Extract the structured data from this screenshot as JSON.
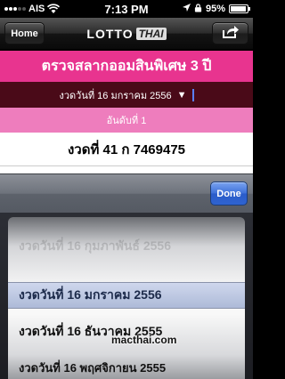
{
  "status_bar": {
    "carrier": "AIS",
    "time": "7:13 PM",
    "battery": "95%",
    "battery_level": 0.95,
    "signal_icon": "signal-dots-icon",
    "wifi_icon": "wifi-icon",
    "location_icon": "location-arrow-icon"
  },
  "navbar": {
    "home_label": "Home",
    "title_main": "LOTTO",
    "title_sub": "THAI",
    "share_icon": "share-icon"
  },
  "header": {
    "title": "ตรวจสลากออมสินพิเศษ 3 ปี"
  },
  "date_selector": {
    "value": "งวดวันที่ 16 มกราคม 2556",
    "arrow": "▼"
  },
  "rank": {
    "label": "อันดับที่ 1"
  },
  "result": {
    "text": "งวดที่ 41 ก 7469475"
  },
  "picker": {
    "done_label": "Done",
    "items": [
      "งวดวันที่ 16 กุมภาพันธ์ 2556",
      "งวดวันที่ 16 มกราคม 2556",
      "งวดวันที่ 16 ธันวาคม 2555",
      "งวดวันที่ 16 พฤศจิกายน 2555"
    ]
  },
  "watermark": "macthai.com",
  "colors": {
    "pink_header": "#e8348f",
    "date_bar": "#4a0a18",
    "rank_bar": "#ee7dbd",
    "done_button": "#2f63d0"
  }
}
